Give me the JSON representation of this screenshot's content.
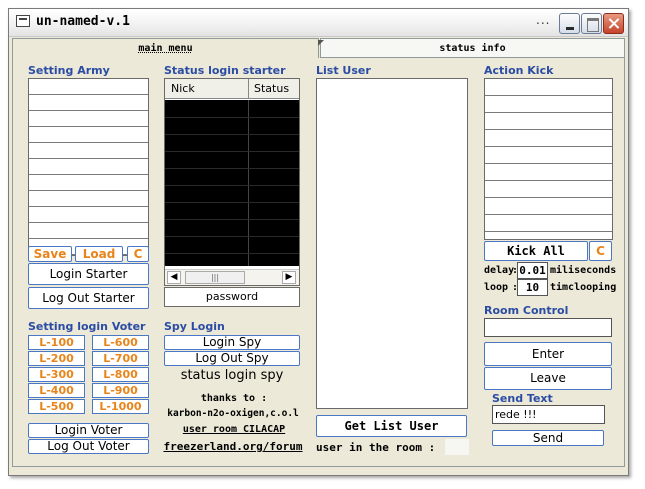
{
  "window": {
    "title": "un-named-v.1",
    "dots": "..."
  },
  "tabs": [
    {
      "label": "main menu"
    },
    {
      "label": "status info"
    }
  ],
  "army": {
    "heading": "Setting Army",
    "rows": 11,
    "save": "Save",
    "load": "Load",
    "c": "C",
    "login_starter": "Login Starter",
    "logout_starter": "Log Out Starter"
  },
  "status_login": {
    "heading": "Status login starter",
    "col_nick": "Nick",
    "col_status": "Status",
    "scroll_thumb": "|||",
    "password": "password"
  },
  "voter": {
    "heading": "Setting login Voter",
    "buttons_left": [
      "L-100",
      "L-200",
      "L-300",
      "L-400",
      "L-500"
    ],
    "buttons_right": [
      "L-600",
      "L-700",
      "L-800",
      "L-900",
      "L-1000"
    ],
    "login_voter": "Login Voter",
    "logout_voter": "Log Out Voter"
  },
  "spy": {
    "heading": "Spy Login",
    "login_spy": "Login Spy",
    "logout_spy": "Log Out Spy",
    "status": "status login spy"
  },
  "credits": {
    "line1": "thanks to :",
    "line2": "karbon-n2o-oxigen,c.o.l",
    "line3": "user room CILACAP",
    "line4": "freezerland.org/forum"
  },
  "list_user": {
    "heading": "List User",
    "get_button": "Get List User",
    "in_room_label": "user in the room :"
  },
  "kick": {
    "heading": "Action Kick",
    "rows": 9,
    "kick_all": "Kick  All",
    "c": "C",
    "delay_label": "delay",
    "delay_value": "0.01",
    "delay_unit": "miliseconds",
    "loop_label": "loop",
    "loop_value": "10",
    "loop_unit": "timclooping"
  },
  "room": {
    "heading": "Room Control",
    "room_value": "",
    "enter": "Enter",
    "leave": "Leave"
  },
  "send": {
    "heading": "Send Text",
    "text_value": "rede !!!",
    "send": "Send"
  },
  "colors": {
    "heading": "#2a4ca4",
    "accent": "#e8841a",
    "panel": "#ece9d8"
  }
}
